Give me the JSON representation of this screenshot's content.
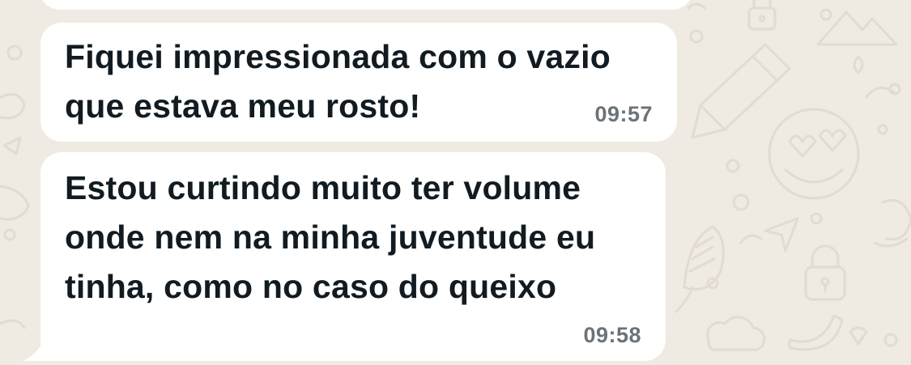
{
  "messages": [
    {
      "text": "Fiquei impressionada com o vazio\nque estava meu rosto!",
      "time": "09:57"
    },
    {
      "text": "Estou curtindo muito ter volume\nonde nem na minha juventude eu\ntinha, como no caso do queixo",
      "time": "09:58"
    }
  ],
  "colors": {
    "background": "#efeae2",
    "bubble": "#ffffff",
    "text": "#111b21",
    "time": "#6b7378",
    "doodle": "#e2dbcf"
  },
  "background_icons": [
    "lock-icon",
    "mountain-icon",
    "pencil-icon",
    "heart-eyes-smiley-icon",
    "paper-plane-icon",
    "corn-icon",
    "padlock-icon",
    "cloud-icon",
    "sun-icon",
    "chili-icon"
  ]
}
